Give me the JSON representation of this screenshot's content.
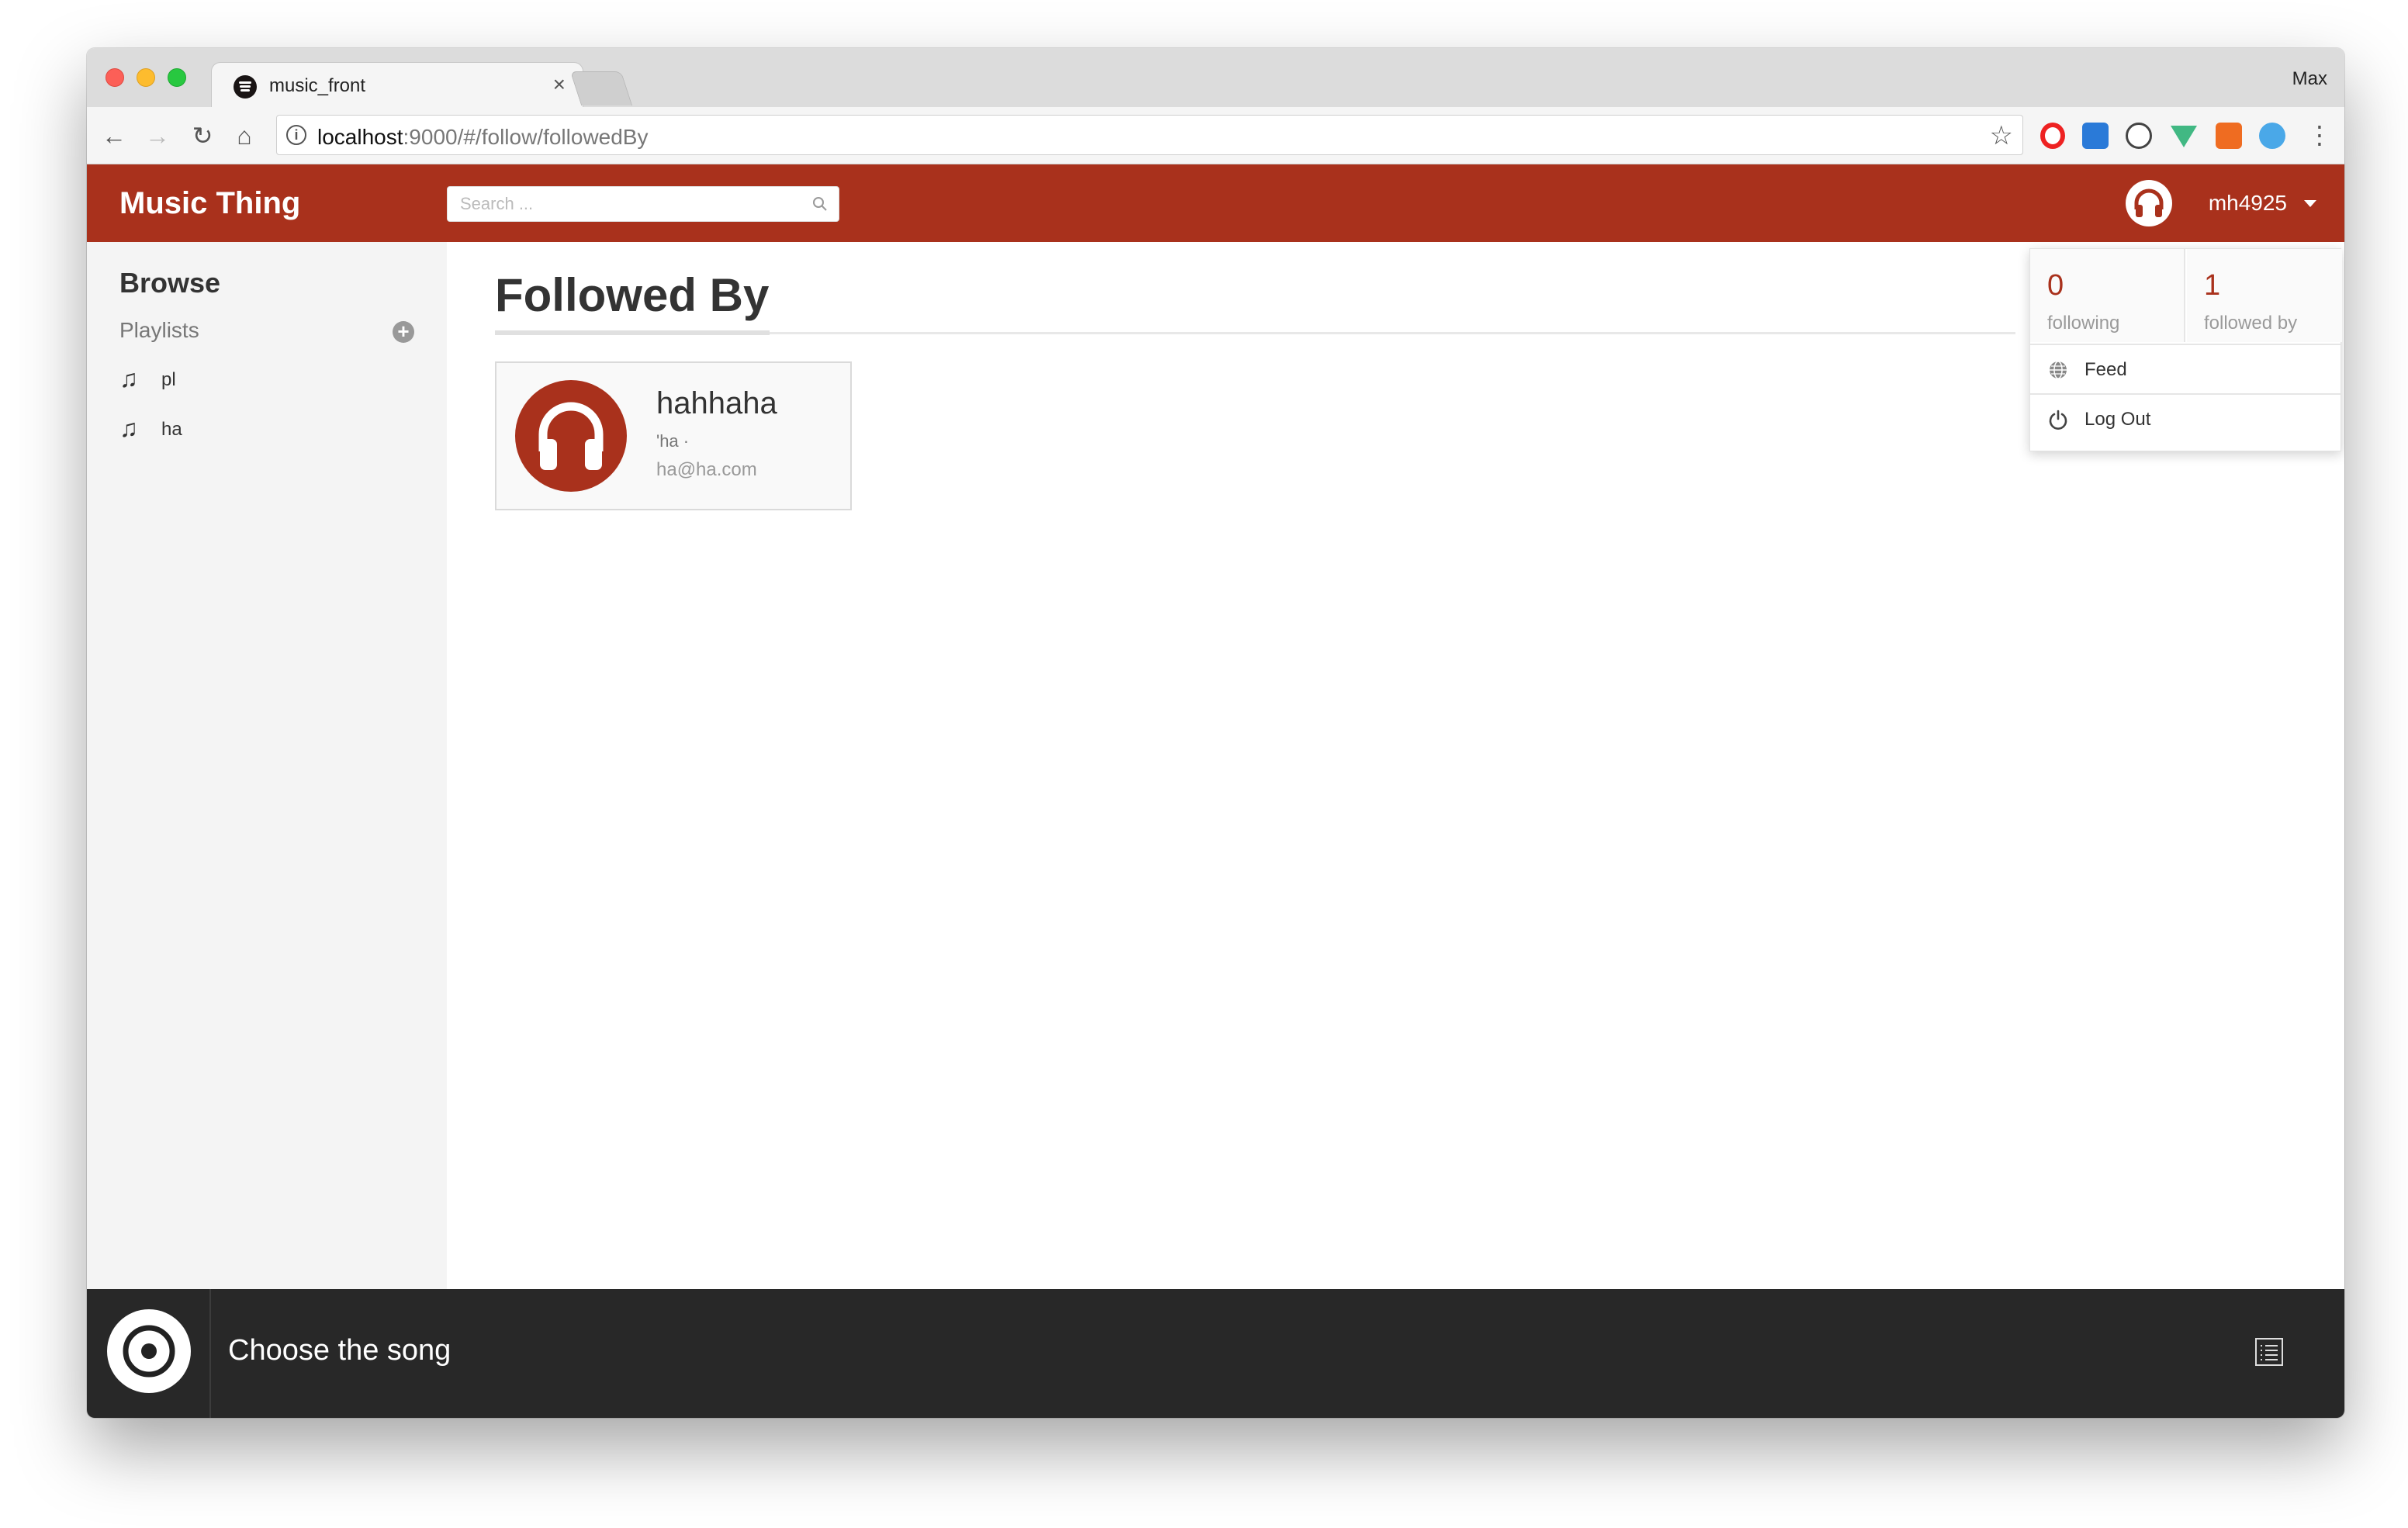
{
  "browser": {
    "tab_title": "music_front",
    "tab_close": "×",
    "profile_name": "Max",
    "url_host": "localhost",
    "url_rest": ":9000/#/follow/followedBy"
  },
  "app": {
    "brand": "Music Thing",
    "search": {
      "placeholder": "Search ..."
    },
    "user": {
      "name": "mh4925"
    },
    "colors": {
      "primary": "#a9311c",
      "player": "#282828",
      "sidebar": "#f4f4f4"
    }
  },
  "sidebar": {
    "title": "Browse",
    "section": "Playlists",
    "playlists": [
      {
        "label": "pl"
      },
      {
        "label": "ha"
      }
    ]
  },
  "main": {
    "title": "Followed By",
    "users": [
      {
        "name": "hahhaha",
        "handle": "'ha ·",
        "email": "ha@ha.com"
      }
    ]
  },
  "dropdown": {
    "following_count": "0",
    "following_label": "following",
    "followed_count": "1",
    "followed_label": "followed by",
    "items": [
      {
        "label": "Feed",
        "icon": "globe-icon"
      },
      {
        "label": "Log Out",
        "icon": "power-icon"
      }
    ]
  },
  "player": {
    "title": "Choose the song"
  }
}
